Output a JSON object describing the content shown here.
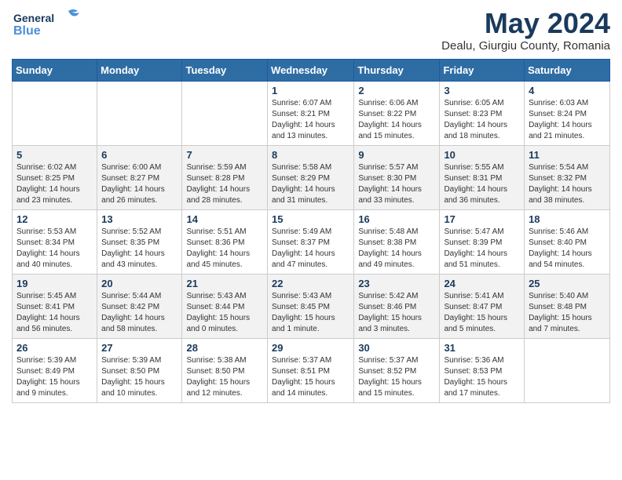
{
  "logo": {
    "line1": "General",
    "line2": "Blue"
  },
  "title": "May 2024",
  "subtitle": "Dealu, Giurgiu County, Romania",
  "days_of_week": [
    "Sunday",
    "Monday",
    "Tuesday",
    "Wednesday",
    "Thursday",
    "Friday",
    "Saturday"
  ],
  "weeks": [
    [
      {
        "day": "",
        "info": ""
      },
      {
        "day": "",
        "info": ""
      },
      {
        "day": "",
        "info": ""
      },
      {
        "day": "1",
        "info": "Sunrise: 6:07 AM\nSunset: 8:21 PM\nDaylight: 14 hours\nand 13 minutes."
      },
      {
        "day": "2",
        "info": "Sunrise: 6:06 AM\nSunset: 8:22 PM\nDaylight: 14 hours\nand 15 minutes."
      },
      {
        "day": "3",
        "info": "Sunrise: 6:05 AM\nSunset: 8:23 PM\nDaylight: 14 hours\nand 18 minutes."
      },
      {
        "day": "4",
        "info": "Sunrise: 6:03 AM\nSunset: 8:24 PM\nDaylight: 14 hours\nand 21 minutes."
      }
    ],
    [
      {
        "day": "5",
        "info": "Sunrise: 6:02 AM\nSunset: 8:25 PM\nDaylight: 14 hours\nand 23 minutes."
      },
      {
        "day": "6",
        "info": "Sunrise: 6:00 AM\nSunset: 8:27 PM\nDaylight: 14 hours\nand 26 minutes."
      },
      {
        "day": "7",
        "info": "Sunrise: 5:59 AM\nSunset: 8:28 PM\nDaylight: 14 hours\nand 28 minutes."
      },
      {
        "day": "8",
        "info": "Sunrise: 5:58 AM\nSunset: 8:29 PM\nDaylight: 14 hours\nand 31 minutes."
      },
      {
        "day": "9",
        "info": "Sunrise: 5:57 AM\nSunset: 8:30 PM\nDaylight: 14 hours\nand 33 minutes."
      },
      {
        "day": "10",
        "info": "Sunrise: 5:55 AM\nSunset: 8:31 PM\nDaylight: 14 hours\nand 36 minutes."
      },
      {
        "day": "11",
        "info": "Sunrise: 5:54 AM\nSunset: 8:32 PM\nDaylight: 14 hours\nand 38 minutes."
      }
    ],
    [
      {
        "day": "12",
        "info": "Sunrise: 5:53 AM\nSunset: 8:34 PM\nDaylight: 14 hours\nand 40 minutes."
      },
      {
        "day": "13",
        "info": "Sunrise: 5:52 AM\nSunset: 8:35 PM\nDaylight: 14 hours\nand 43 minutes."
      },
      {
        "day": "14",
        "info": "Sunrise: 5:51 AM\nSunset: 8:36 PM\nDaylight: 14 hours\nand 45 minutes."
      },
      {
        "day": "15",
        "info": "Sunrise: 5:49 AM\nSunset: 8:37 PM\nDaylight: 14 hours\nand 47 minutes."
      },
      {
        "day": "16",
        "info": "Sunrise: 5:48 AM\nSunset: 8:38 PM\nDaylight: 14 hours\nand 49 minutes."
      },
      {
        "day": "17",
        "info": "Sunrise: 5:47 AM\nSunset: 8:39 PM\nDaylight: 14 hours\nand 51 minutes."
      },
      {
        "day": "18",
        "info": "Sunrise: 5:46 AM\nSunset: 8:40 PM\nDaylight: 14 hours\nand 54 minutes."
      }
    ],
    [
      {
        "day": "19",
        "info": "Sunrise: 5:45 AM\nSunset: 8:41 PM\nDaylight: 14 hours\nand 56 minutes."
      },
      {
        "day": "20",
        "info": "Sunrise: 5:44 AM\nSunset: 8:42 PM\nDaylight: 14 hours\nand 58 minutes."
      },
      {
        "day": "21",
        "info": "Sunrise: 5:43 AM\nSunset: 8:44 PM\nDaylight: 15 hours\nand 0 minutes."
      },
      {
        "day": "22",
        "info": "Sunrise: 5:43 AM\nSunset: 8:45 PM\nDaylight: 15 hours\nand 1 minute."
      },
      {
        "day": "23",
        "info": "Sunrise: 5:42 AM\nSunset: 8:46 PM\nDaylight: 15 hours\nand 3 minutes."
      },
      {
        "day": "24",
        "info": "Sunrise: 5:41 AM\nSunset: 8:47 PM\nDaylight: 15 hours\nand 5 minutes."
      },
      {
        "day": "25",
        "info": "Sunrise: 5:40 AM\nSunset: 8:48 PM\nDaylight: 15 hours\nand 7 minutes."
      }
    ],
    [
      {
        "day": "26",
        "info": "Sunrise: 5:39 AM\nSunset: 8:49 PM\nDaylight: 15 hours\nand 9 minutes."
      },
      {
        "day": "27",
        "info": "Sunrise: 5:39 AM\nSunset: 8:50 PM\nDaylight: 15 hours\nand 10 minutes."
      },
      {
        "day": "28",
        "info": "Sunrise: 5:38 AM\nSunset: 8:50 PM\nDaylight: 15 hours\nand 12 minutes."
      },
      {
        "day": "29",
        "info": "Sunrise: 5:37 AM\nSunset: 8:51 PM\nDaylight: 15 hours\nand 14 minutes."
      },
      {
        "day": "30",
        "info": "Sunrise: 5:37 AM\nSunset: 8:52 PM\nDaylight: 15 hours\nand 15 minutes."
      },
      {
        "day": "31",
        "info": "Sunrise: 5:36 AM\nSunset: 8:53 PM\nDaylight: 15 hours\nand 17 minutes."
      },
      {
        "day": "",
        "info": ""
      }
    ]
  ]
}
